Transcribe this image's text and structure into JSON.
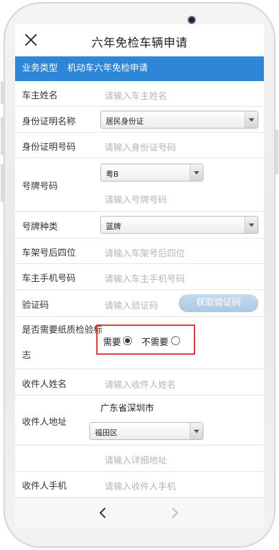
{
  "nav": {
    "title": "六年免检车辆申请",
    "close_icon": "close-icon"
  },
  "banner": {
    "key": "业务类型",
    "value": "机动车六年免检申请"
  },
  "form": {
    "owner_name": {
      "label": "车主姓名",
      "placeholder": "请输入车主姓名"
    },
    "id_type": {
      "label": "身份证明名称",
      "value": "居民身份证"
    },
    "id_number": {
      "label": "身份证明号码",
      "placeholder": "请输入身份证号码"
    },
    "plate": {
      "label": "号牌号码",
      "prefix_value": "粤B",
      "placeholder": "请输入号牌号码"
    },
    "plate_type": {
      "label": "号牌种类",
      "value": "蓝牌"
    },
    "vin4": {
      "label": "车架号后四位",
      "placeholder": "请输入车架号后四位"
    },
    "phone": {
      "label": "车主手机号码",
      "placeholder": "请输入车主手机号码"
    },
    "code": {
      "label": "验证码",
      "placeholder": "请输入验证码",
      "button": "获取验证码"
    },
    "paper_mark": {
      "label_line1": "是否需要纸质检验标",
      "label_line2": "志",
      "option_yes": "需要",
      "option_no": "不需要",
      "selected": "需要"
    },
    "recipient_name": {
      "label": "收件人姓名",
      "placeholder": "请输入收件人姓名"
    },
    "address": {
      "label": "收件人地址",
      "region": "广东省深圳市",
      "district": "福田区",
      "detail_placeholder": "请输入详细地址"
    },
    "recipient_phone": {
      "label": "收件人手机",
      "placeholder": "请输入收件人手机"
    }
  },
  "toolbar": {
    "back_icon": "chevron-left-icon",
    "forward_icon": "chevron-right-icon"
  },
  "colors": {
    "banner": "#2e86d6",
    "highlight_box": "#d63a3a",
    "code_button": "#b5d0e8"
  }
}
